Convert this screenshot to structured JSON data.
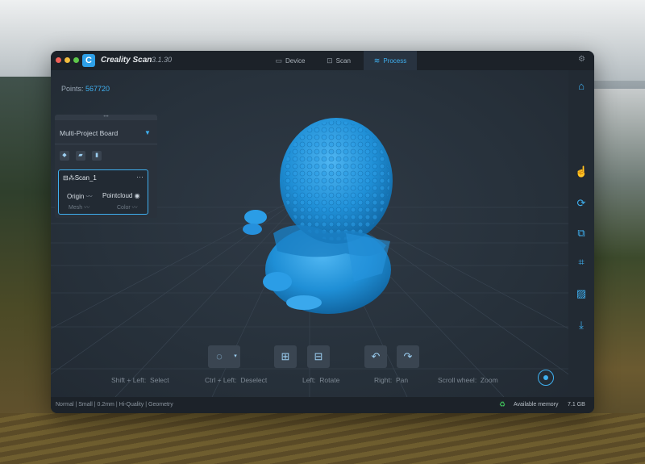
{
  "app": {
    "name": "Creality Scan",
    "version": "3.1.30",
    "logo_glyph": "C"
  },
  "tabs": [
    {
      "label": "Device",
      "icon": "device-icon",
      "glyph": "▭"
    },
    {
      "label": "Scan",
      "icon": "scan-icon",
      "glyph": "⊡"
    },
    {
      "label": "Process",
      "icon": "process-icon",
      "glyph": "≋",
      "active": true
    }
  ],
  "viewport": {
    "points_label": "Points:",
    "points_value": "567720"
  },
  "project_panel": {
    "title": "Multi-Project Board",
    "toolbar": [
      {
        "name": "cube-icon",
        "glyph": "◆"
      },
      {
        "name": "folder-icon",
        "glyph": "▰"
      },
      {
        "name": "trash-icon",
        "glyph": "▮"
      }
    ],
    "scan": {
      "name": "Scan_1",
      "more": "···",
      "origin_label": "Origin",
      "pointcloud_label": "Pointcloud",
      "mesh_label": "Mesh",
      "color_label": "Color"
    }
  },
  "right_toolbar": [
    {
      "name": "home-icon",
      "glyph": "⌂"
    },
    {
      "name": "hand-pointer-icon",
      "glyph": "☝"
    },
    {
      "name": "lasso-icon",
      "glyph": "⟳"
    },
    {
      "name": "merge-icon",
      "glyph": "⧉"
    },
    {
      "name": "chip-icon",
      "glyph": "⌗"
    },
    {
      "name": "image-icon",
      "glyph": "▨"
    },
    {
      "name": "download-icon",
      "glyph": "⤓"
    }
  ],
  "bottom_toolbar": [
    {
      "name": "lasso-select-icon",
      "glyph": "◌"
    },
    {
      "name": "select-dropdown-icon",
      "glyph": "▾"
    },
    {
      "name": "select-all-icon",
      "glyph": "⊞"
    },
    {
      "name": "invert-select-icon",
      "glyph": "⊟"
    },
    {
      "name": "undo-icon",
      "glyph": "↶"
    },
    {
      "name": "redo-icon",
      "glyph": "↷"
    }
  ],
  "hints": [
    {
      "key": "Shift + Left:",
      "action": "Select"
    },
    {
      "key": "Ctrl + Left:",
      "action": "Deselect"
    },
    {
      "key": "Left:",
      "action": "Rotate"
    },
    {
      "key": "Right:",
      "action": "Pan"
    },
    {
      "key": "Scroll wheel:",
      "action": "Zoom"
    }
  ],
  "status": {
    "settings": "Normal | Small | 0.2mm | Hi-Quality | Geometry",
    "memory_label": "Available memory",
    "memory_value": "7.1 GB"
  },
  "colors": {
    "accent": "#3fb0f0",
    "model": "#1f8fd6",
    "background": "#222a33"
  }
}
